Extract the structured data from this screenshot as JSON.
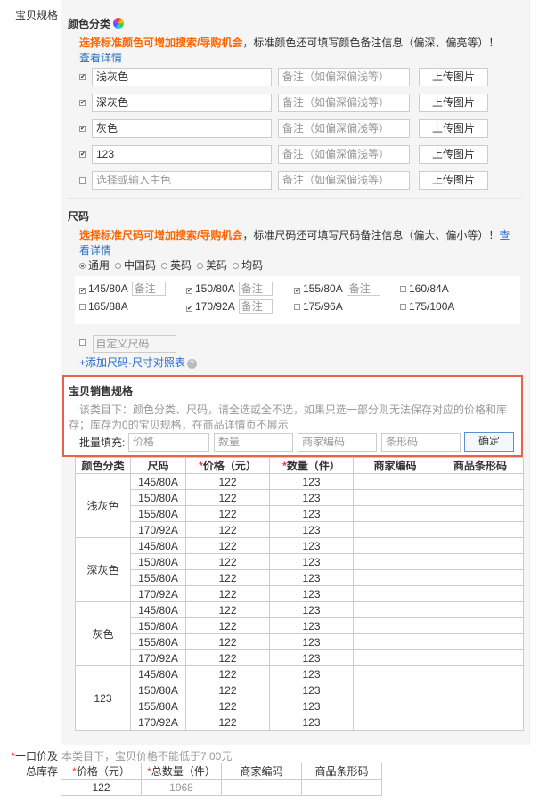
{
  "labels": {
    "spec": "宝贝规格",
    "price_star": "*",
    "price": "一口价及",
    "stock": "总库存"
  },
  "color": {
    "title": "颜色分类",
    "tip_hl": "选择标准颜色可增加搜索/导购机会",
    "tip_rest": "，标准颜色还可填写颜色备注信息（偏深、偏亮等）！",
    "tip_link": "查看详情",
    "rows": [
      {
        "checked": true,
        "name": "浅灰色",
        "note": "备注（如偏深偏浅等）",
        "upload": "上传图片"
      },
      {
        "checked": true,
        "name": "深灰色",
        "note": "备注（如偏深偏浅等）",
        "upload": "上传图片"
      },
      {
        "checked": true,
        "name": "灰色",
        "note": "备注（如偏深偏浅等）",
        "upload": "上传图片"
      },
      {
        "checked": true,
        "name": "123",
        "note": "备注（如偏深偏浅等）",
        "upload": "上传图片"
      },
      {
        "checked": false,
        "name": "选择或输入主色",
        "note": "备注（如偏深偏浅等）",
        "upload": "上传图片"
      }
    ]
  },
  "size": {
    "title": "尺码",
    "tip_hl": "选择标准尺码可增加搜索/导购机会",
    "tip_rest": "，标准尺码还可填写尺码备注信息（偏大、偏小等）！",
    "tip_link1": "查",
    "tip_link2": "看详情",
    "types": [
      "通用",
      "中国码",
      "英码",
      "美码",
      "均码"
    ],
    "items": [
      {
        "label": "145/80A",
        "checked": true,
        "note": "备注"
      },
      {
        "label": "150/80A",
        "checked": true,
        "note": "备注"
      },
      {
        "label": "155/80A",
        "checked": true,
        "note": "备注"
      },
      {
        "label": "160/84A",
        "checked": false
      },
      {
        "label": "165/88A",
        "checked": false
      },
      {
        "label": "170/92A",
        "checked": true,
        "note": "备注"
      },
      {
        "label": "175/96A",
        "checked": false
      },
      {
        "label": "175/100A",
        "checked": false
      }
    ],
    "custom": "自定义尺码",
    "add_link": "+添加尺码-尺寸对照表",
    "help": "?"
  },
  "sales": {
    "title": "宝贝销售规格",
    "desc1": "该类目下：颜色分类、尺码，请全选或全不选，如果只选一部分则无法保存对应的价格和库",
    "desc2": "存；库存为0的宝贝规格，在商品详情页不展示",
    "batch_label": "批量填充:",
    "ph_price": "价格",
    "ph_qty": "数量",
    "ph_code": "商家编码",
    "ph_barcode": "条形码",
    "confirm": "确定"
  },
  "sku_table": {
    "headers": {
      "color": "颜色分类",
      "size": "尺码",
      "price": "价格（元）",
      "qty": "数量（件）",
      "code": "商家编码",
      "barcode": "商品条形码"
    },
    "groups": [
      {
        "color": "浅灰色",
        "rows": [
          {
            "size": "145/80A",
            "price": "122",
            "qty": "123"
          },
          {
            "size": "150/80A",
            "price": "122",
            "qty": "123"
          },
          {
            "size": "155/80A",
            "price": "122",
            "qty": "123"
          },
          {
            "size": "170/92A",
            "price": "122",
            "qty": "123"
          }
        ]
      },
      {
        "color": "深灰色",
        "rows": [
          {
            "size": "145/80A",
            "price": "122",
            "qty": "123"
          },
          {
            "size": "150/80A",
            "price": "122",
            "qty": "123"
          },
          {
            "size": "155/80A",
            "price": "122",
            "qty": "123"
          },
          {
            "size": "170/92A",
            "price": "122",
            "qty": "123"
          }
        ]
      },
      {
        "color": "灰色",
        "rows": [
          {
            "size": "145/80A",
            "price": "122",
            "qty": "123"
          },
          {
            "size": "150/80A",
            "price": "122",
            "qty": "123"
          },
          {
            "size": "155/80A",
            "price": "122",
            "qty": "123"
          },
          {
            "size": "170/92A",
            "price": "122",
            "qty": "123"
          }
        ]
      },
      {
        "color": "123",
        "rows": [
          {
            "size": "145/80A",
            "price": "122",
            "qty": "123"
          },
          {
            "size": "150/80A",
            "price": "122",
            "qty": "123"
          },
          {
            "size": "155/80A",
            "price": "122",
            "qty": "123"
          },
          {
            "size": "170/92A",
            "price": "122",
            "qty": "123"
          }
        ]
      }
    ]
  },
  "price_note": "本类目下，宝贝价格不能低于7.00元",
  "summary": {
    "headers": {
      "price": "价格（元）",
      "qty": "总数量（件）",
      "code": "商家编码",
      "barcode": "商品条形码"
    },
    "values": {
      "price": "122",
      "qty": "1968",
      "code": "",
      "barcode": ""
    }
  },
  "colors": {
    "accent": "#f60",
    "link": "#2a6ecb",
    "required": "#f33",
    "highlight_border": "#e8614a"
  }
}
